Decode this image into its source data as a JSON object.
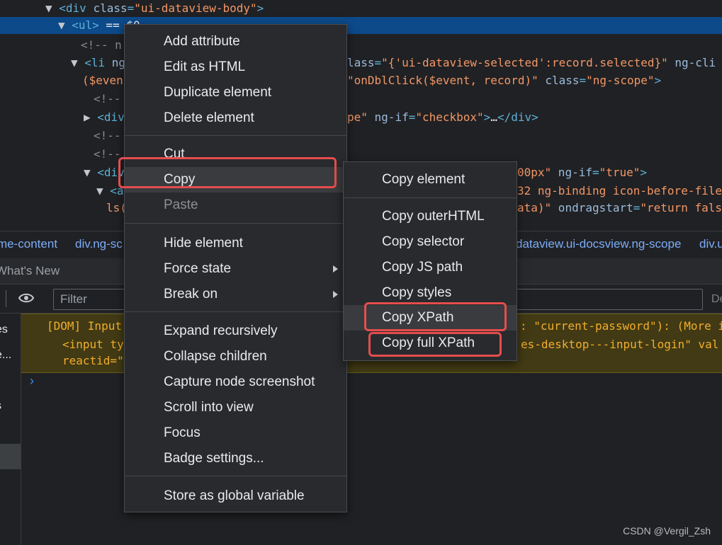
{
  "dom_tree": {
    "lines": [
      {
        "id": "l0",
        "parts": [
          [
            "arrow",
            "▼"
          ],
          [
            "tag",
            "<div "
          ],
          [
            "attr",
            "class"
          ],
          [
            "tag",
            "="
          ],
          [
            "val",
            "\"ui-dataview-body\""
          ],
          [
            "tag",
            ">"
          ]
        ]
      },
      {
        "id": "l1",
        "parts": [
          [
            "arrow",
            "▼"
          ],
          [
            "tag",
            "<ul>"
          ],
          [
            "ccc",
            " == $0"
          ]
        ]
      },
      {
        "id": "l2",
        "parts": [
          [
            "cmt",
            "<!-- n"
          ]
        ]
      },
      {
        "id": "l3",
        "parts": [
          [
            "arrow",
            "▼"
          ],
          [
            "tag",
            "<li "
          ],
          [
            "attr",
            "ng"
          ]
        ]
      },
      {
        "id": "l3b",
        "parts": [
          [
            "attr",
            "lass"
          ],
          [
            "tag",
            "="
          ],
          [
            "val",
            "\"{'ui-dataview-selected':record.selected}\""
          ],
          [
            "attr",
            " ng-cli"
          ]
        ]
      },
      {
        "id": "l4",
        "parts": [
          [
            "val",
            "($even"
          ]
        ]
      },
      {
        "id": "l4b",
        "parts": [
          [
            "val",
            "\"onDblClick($event, record)\""
          ],
          [
            "attr",
            " class"
          ],
          [
            "tag",
            "="
          ],
          [
            "val",
            "\"ng-scope\""
          ],
          [
            "tag",
            ">"
          ]
        ]
      },
      {
        "id": "l5",
        "parts": [
          [
            "cmt",
            "<!--"
          ]
        ]
      },
      {
        "id": "l6",
        "parts": [
          [
            "arrow",
            "▶"
          ],
          [
            "tag",
            "<div"
          ]
        ]
      },
      {
        "id": "l6b",
        "parts": [
          [
            "val",
            "pe\""
          ],
          [
            "attr",
            " ng-if"
          ],
          [
            "tag",
            "="
          ],
          [
            "val",
            "\"checkbox\""
          ],
          [
            "tag",
            ">"
          ],
          [
            "ptx",
            "…"
          ],
          [
            "tag",
            "</div>"
          ]
        ]
      },
      {
        "id": "l7",
        "parts": [
          [
            "cmt",
            "<!--"
          ]
        ]
      },
      {
        "id": "l8",
        "parts": [
          [
            "cmt",
            "<!--"
          ]
        ]
      },
      {
        "id": "l9",
        "parts": [
          [
            "arrow",
            "▼"
          ],
          [
            "tag",
            "<div"
          ]
        ]
      },
      {
        "id": "l9b",
        "parts": [
          [
            "val",
            "00px\""
          ],
          [
            "attr",
            " ng-if"
          ],
          [
            "tag",
            "="
          ],
          [
            "val",
            "\"true\""
          ],
          [
            "tag",
            ">"
          ]
        ]
      },
      {
        "id": "l10",
        "parts": [
          [
            "arrow",
            "▼"
          ],
          [
            "tag",
            "<a"
          ]
        ]
      },
      {
        "id": "l10b",
        "parts": [
          [
            "val",
            "32 ng-binding icon-before-file"
          ]
        ]
      },
      {
        "id": "l11",
        "parts": [
          [
            "val",
            "ls("
          ]
        ]
      },
      {
        "id": "l11b",
        "parts": [
          [
            "val",
            "ata)\""
          ],
          [
            "attr",
            " ondragstart"
          ],
          [
            "tag",
            "="
          ],
          [
            "val",
            "\"return fals"
          ]
        ]
      }
    ]
  },
  "breadcrumb": [
    "me-content",
    "div.ng-sc",
    "dataview.ui-docsview.ng-scope",
    "div.u"
  ],
  "drawer": {
    "tab": "What's New"
  },
  "console": {
    "filter_placeholder": "Filter",
    "levels_label": "De",
    "warning": {
      "line1_left": "[DOM] Input",
      "line1_right": ": \"current-password\"): (More i",
      "line2_left": "<input ty",
      "line2_right": "es-desktop---input-login\" val",
      "line3": "reactid=\""
    },
    "prompt": "›"
  },
  "sidebar": [
    "es",
    "e...",
    "s"
  ],
  "context_menu": {
    "items": [
      "Add attribute",
      "Edit as HTML",
      "Duplicate element",
      "Delete element",
      "Cut",
      "Copy",
      "Paste",
      "Hide element",
      "Force state",
      "Break on",
      "Expand recursively",
      "Collapse children",
      "Capture node screenshot",
      "Scroll into view",
      "Focus",
      "Badge settings...",
      "Store as global variable"
    ]
  },
  "copy_submenu": {
    "items": [
      "Copy element",
      "Copy outerHTML",
      "Copy selector",
      "Copy JS path",
      "Copy styles",
      "Copy XPath",
      "Copy full XPath"
    ]
  },
  "watermark": "CSDN @Vergil_Zsh",
  "colors": {
    "selection": "#0c4a8a",
    "highlight_box": "#e54d4d",
    "menu_bg": "#292a2d",
    "warning_bg": "#413a14"
  }
}
